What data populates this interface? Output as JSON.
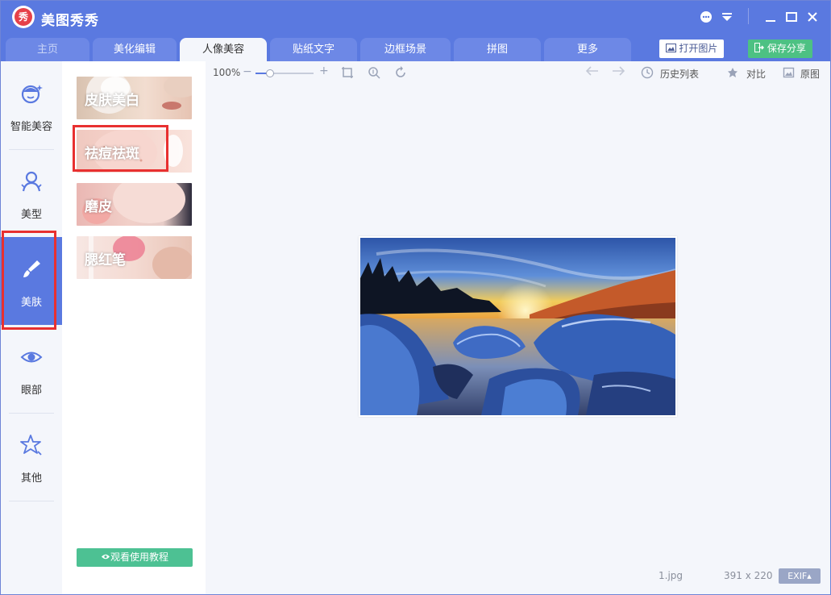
{
  "app": {
    "title": "美图秀秀",
    "logo_text": "秀"
  },
  "tabs": [
    {
      "label": "主页"
    },
    {
      "label": "美化编辑"
    },
    {
      "label": "人像美容"
    },
    {
      "label": "贴纸文字"
    },
    {
      "label": "边框场景"
    },
    {
      "label": "拼图"
    },
    {
      "label": "更多"
    }
  ],
  "header_buttons": {
    "open_image": "打开图片",
    "save_share": "保存分享"
  },
  "sidebar": {
    "items": [
      {
        "label": "智能美容",
        "icon": "face-smile-icon"
      },
      {
        "label": "美型",
        "icon": "person-icon"
      },
      {
        "label": "美肤",
        "icon": "brush-icon"
      },
      {
        "label": "眼部",
        "icon": "eye-icon"
      },
      {
        "label": "其他",
        "icon": "star-icon"
      }
    ]
  },
  "tools": {
    "items": [
      {
        "label": "皮肤美白"
      },
      {
        "label": "祛痘祛斑"
      },
      {
        "label": "磨皮"
      },
      {
        "label": "腮红笔"
      }
    ],
    "tutorial": "观看使用教程"
  },
  "toolbar": {
    "zoom": "100%",
    "zoom_level": 0.25,
    "history": "历史列表",
    "compare": "对比",
    "original": "原图"
  },
  "status": {
    "filename": "1.jpg",
    "dimensions": "391 x 220",
    "exif": "EXIF▴"
  },
  "colors": {
    "brand": "#5a79e0",
    "save_green": "#4dc183",
    "highlight_red": "#e83030"
  }
}
